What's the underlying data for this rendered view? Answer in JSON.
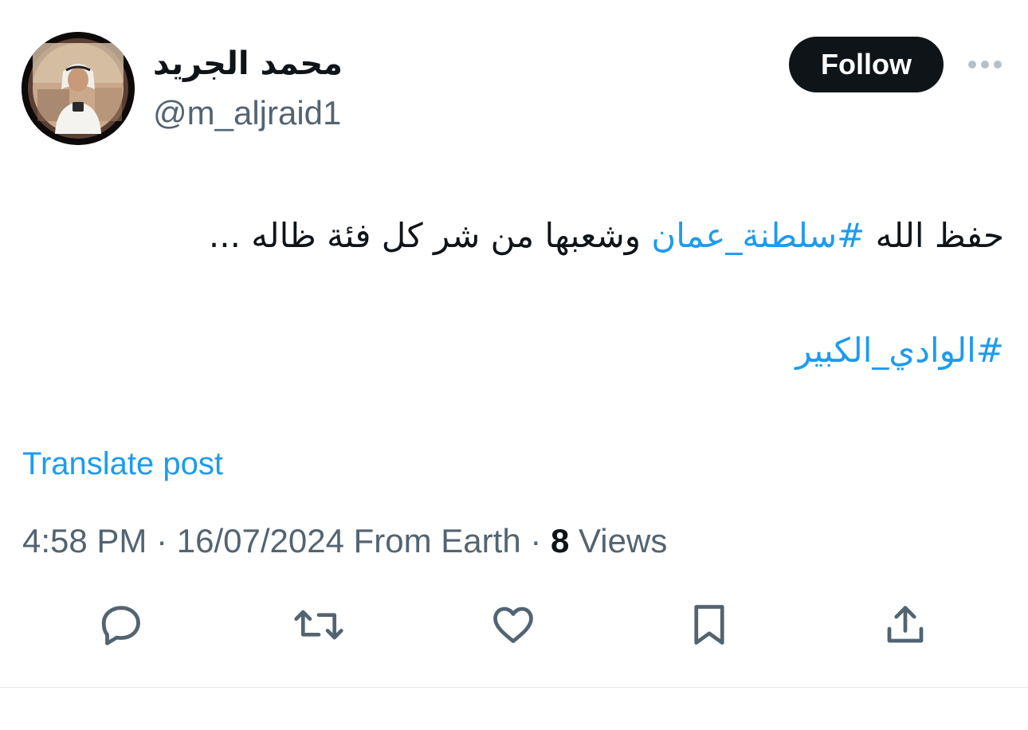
{
  "post": {
    "author": {
      "display_name": "محمد الجريد",
      "handle": "@m_aljraid1"
    },
    "follow_label": "Follow",
    "text": {
      "line1_plain_before": "حفظ الله ",
      "line1_hashtag": "#سلطنة_عمان",
      "line1_plain_after": "  وشعبها من شر كل فئة ظاله ...",
      "line2_hashtag": "#الوادي_الكبير"
    },
    "translate_label": "Translate post",
    "meta": {
      "time": "4:58 PM",
      "separator": " · ",
      "date": "16/07/2024",
      "source": " From Earth",
      "separator2": " · ",
      "views_count": "8",
      "views_label": " Views"
    },
    "actions": [
      "reply-icon",
      "repost-icon",
      "like-icon",
      "bookmark-icon",
      "share-icon"
    ]
  },
  "colors": {
    "accent": "#1d9bf0",
    "text": "#0f1419",
    "secondary": "#536471",
    "follow_bg": "#0f1419"
  }
}
